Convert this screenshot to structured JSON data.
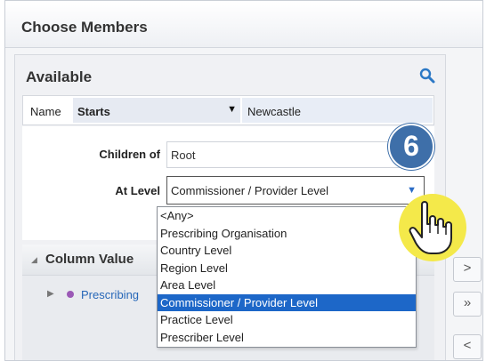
{
  "dialog": {
    "title": "Choose Members"
  },
  "available": {
    "title": "Available",
    "search_icon": "search-icon",
    "name_label": "Name",
    "name_operator": "Starts",
    "name_value": "Newcastle",
    "children_label": "Children of",
    "children_value": "Root",
    "level_label": "At Level",
    "level_value": "Commissioner / Provider Level",
    "level_options": [
      "<Any>",
      "Prescribing Organisation",
      "Country Level",
      "Region Level",
      "Area Level",
      "Commissioner / Provider Level",
      "Practice Level",
      "Prescriber Level"
    ],
    "selected_option": "Commissioner / Provider Level"
  },
  "column_values": {
    "title": "Column Value",
    "tree_item": "Prescribing"
  },
  "shuttle": {
    "move": ">",
    "move_all": "»",
    "remove": "<"
  },
  "annotation": {
    "step": "6",
    "cursor_icon": "hand-pointer-icon",
    "colors": {
      "badge": "#3e6fa9",
      "halo": "#f4e94a"
    }
  },
  "colors": {
    "selection": "#1d67c8",
    "link": "#2767b8"
  }
}
